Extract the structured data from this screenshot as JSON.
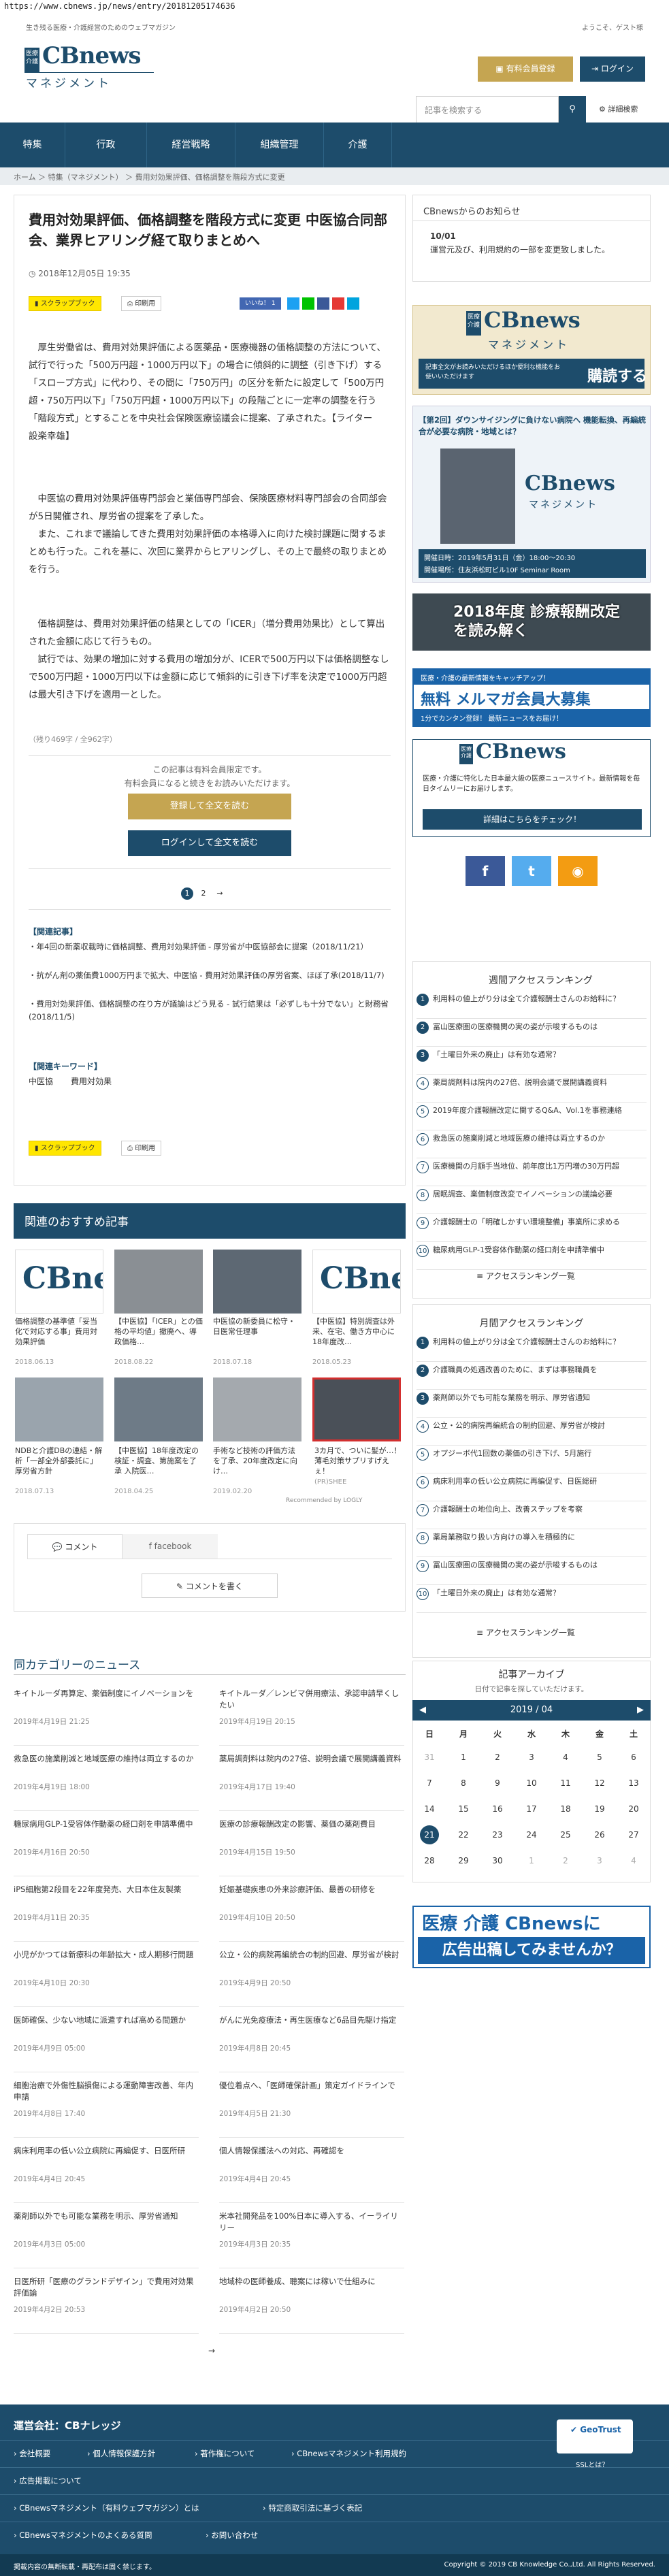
{
  "browser": {
    "url": "https://www.cbnews.jp/news/entry/20181205174636"
  },
  "header": {
    "tagline": "生き残る医療・介護経営のためのウェブマガジン",
    "welcome": "ようこそ、ゲスト様",
    "logo_small": "医療介護",
    "logo_main": "CBnews",
    "logo_sub": "マネジメント",
    "subscribe_label": "有料会員登録",
    "login_label": "ログイン"
  },
  "search": {
    "placeholder": "記事を検索する",
    "advanced_label": "詳細検索"
  },
  "nav": {
    "items": [
      "特集",
      "行政",
      "経営戦略",
      "組織管理",
      "介護"
    ]
  },
  "breadcrumb": {
    "items": [
      "ホーム",
      "特集（マネジメント）",
      "費用対効果評価、価格調整を階段方式に変更"
    ]
  },
  "article": {
    "title": "費用対効果評価、価格調整を階段方式に変更 中医協合同部会、業界ヒアリング経て取りまとめへ",
    "date": "2018年12月05日 19:35",
    "scrapbook_label": "スクラップブック",
    "print_label": "印刷用",
    "likes_label": "いいね！ 1",
    "p1": "　厚生労働省は、費用対効果評価による医薬品・医療機器の価格調整の方法について、試行で行った「500万円超・1000万円以下」の場合に傾斜的に調整（引き下げ）する「スロープ方式」に代わり、その間に「750万円」の区分を新たに設定して「500万円超・750万円以下」「750万円超・1000万円以下」の段階ごとに一定率の調整を行う「階段方式」とすることを中央社会保険医療協議会に提案、了承された。【ライター　設楽幸雄】",
    "p2": "　中医協の費用対効果評価専門部会と業価専門部会、保険医療材料専門部会の合同部会が5日開催され、厚労省の提案を了承した。\n　また、これまで議論してきた費用対効果評価の本格導入に向けた検討課題に関するまとめも行った。これを基に、次回に業界からヒアリングし、その上で最終の取りまとめを行う。",
    "p3": "　価格調整は、費用対効果評価の結果としての「ICER」（増分費用効果比）として算出された金額に応じて行うもの。\n　試行では、効果の増加に対する費用の増加分が、ICERで500万円以下は価格調整なしで500万円超・1000万円以下は金額に応じて傾斜的に引き下げ率を決定で1000万円超は最大引き下げを適用一とした。",
    "remaining": "（残り469字 / 全962字）",
    "paywall_note1": "この記事は有料会員限定です。",
    "paywall_note2": "有料会員になると続きをお読みいただけます。",
    "cta_register": "登録して全文を読む",
    "cta_login": "ログインして全文を読む",
    "pagination": [
      "1",
      "2",
      "→"
    ],
    "related_heading": "【関連記事】",
    "related": [
      "年4回の新薬収載時に価格調整、費用対効果評価 - 厚労省が中医協部会に提案（2018/11/21）",
      "抗がん剤の薬価費1000万円まで拡大、中医協 - 費用対効果評価の厚労省案、ほぼ了承(2018/11/7)",
      "費用対効果評価、価格調整の在り方が議論はどう見る - 試行結果は「必ずしも十分でない」と財務省(2018/11/5)"
    ],
    "keyword_heading": "【関連キーワード】",
    "keywords": [
      "中医協",
      "費用対効果"
    ]
  },
  "recommend": {
    "heading": "関連のおすすめ記事",
    "items": [
      {
        "caption": "価格調整の基準値「妥当化で対応する事」費用対効果評価",
        "date": "2018.06.13"
      },
      {
        "caption": "【中医協】「ICER」との価格の平均値」撤廃へ、導政価格…",
        "date": "2018.08.22"
      },
      {
        "caption": "中医協の新委員に松守・日医常任理事",
        "date": "2018.07.18"
      },
      {
        "caption": "【中医協】特別調査は外来、在宅、働き方中心に 18年度改…",
        "date": "2018.05.23"
      },
      {
        "caption": "NDBと介護DBの連結・解析「一部全外部委託に」厚労省方針",
        "date": "2018.07.13"
      },
      {
        "caption": "【中医協】18年度改定の検証・調査、第施案を了承 入院医…",
        "date": "2018.04.25"
      },
      {
        "caption": "手術など技術の評価方法を了承、20年度改定に向け…",
        "date": "2019.02.20"
      },
      {
        "caption": "3カ月で、ついに髪が…！薄毛対策サプリすげえぇ！",
        "date": "(PR)SHEE"
      }
    ],
    "powered": "Recommended by LOGLY"
  },
  "comments": {
    "tab_comment": "コメント",
    "tab_facebook": "facebook",
    "write_label": "コメントを書く"
  },
  "same_category": {
    "heading": "同カテゴリーのニュース",
    "left": [
      {
        "t": "キイトルーダ再算定、薬価制度にイノベーションを",
        "d": "2019年4月19日 21:25"
      },
      {
        "t": "救急医の施業削減と地域医療の維持は両立するのか",
        "d": "2019年4月19日 18:00"
      },
      {
        "t": "糖尿病用GLP-1受容体作動薬の経口剤を申請準備中",
        "d": "2019年4月16日 20:50"
      },
      {
        "t": "iPS細胞第2段目を22年度発売、大日本住友製薬",
        "d": "2019年4月11日 20:35"
      },
      {
        "t": "小児がかつては新療科の年齢拡大・成人期移行問題",
        "d": "2019年4月10日 20:30"
      },
      {
        "t": "医師確保、少ない地域に派遣すれば高める間題か",
        "d": "2019年4月9日 05:00"
      },
      {
        "t": "細胞治療で外傷性脳損傷による運動障害改善、年内申請",
        "d": "2019年4月8日 17:40"
      },
      {
        "t": "病床利用率の低い公立病院に再編促す、日医所研",
        "d": "2019年4月4日 20:45"
      },
      {
        "t": "薬剤師以外でも可能な業務を明示、厚労省通知",
        "d": "2019年4月3日 05:00"
      },
      {
        "t": "日医所研「医療のグランドデザイン」で費用対効果評価論",
        "d": "2019年4月2日 20:53"
      }
    ],
    "right": [
      {
        "t": "キイトルーダ／レンビマ併用療法、承認申請早くしたい",
        "d": "2019年4月19日 20:15"
      },
      {
        "t": "薬局調剤料は院内の27倍、説明会議で展開講義資料",
        "d": "2019年4月17日 19:40"
      },
      {
        "t": "医療の診療報酬改定の影響、薬価の薬剤費目",
        "d": "2019年4月15日 19:50"
      },
      {
        "t": "妊娠基礎疾患の外来診療評価、最善の研修を",
        "d": "2019年4月10日 20:50"
      },
      {
        "t": "公立・公的病院再編統合の制約回避、厚労省が検討",
        "d": "2019年4月9日 20:50"
      },
      {
        "t": "がんに光免疫療法・再生医療など6品目先駆け指定",
        "d": "2019年4月8日 20:45"
      },
      {
        "t": "優位着点へ、「医師確保計画」策定ガイドラインで",
        "d": "2019年4月5日 21:30"
      },
      {
        "t": "個人情報保護法への対応、再確認を",
        "d": "2019年4月4日 20:45"
      },
      {
        "t": "米本社開発品を100%日本に導入する、イーライリリー",
        "d": "2019年4月3日 20:35"
      },
      {
        "t": "地域枠の医師養成、聴案には稼いで仕組みに",
        "d": "2019年4月2日 20:50"
      }
    ]
  },
  "sidebar": {
    "notice_heading": "CBnewsからのお知らせ",
    "notice_date": "10/01",
    "notice_text": "運営元及び、利用規約の一部を変更致しました。",
    "ad_mgmt_text": "記事全文がお読みいただけるほか便利な機能をお使いいただけます",
    "ad_mgmt_cta": "購読する",
    "seminar_title": "【第2回】ダウンサイジングに負けない病院へ 機能転換、再編統合が必要な病院・地域とは？",
    "seminar_date": "開催日時：2019年5月31日（金）18:00〜20:30",
    "seminar_place": "開催場所：住友浜松町ビル10F Seminar Room",
    "kaitei_text": "2018年度 診療報酬改定を読み解く",
    "mailmag_small": "医療・介護の最新情報をキャッチアップ！",
    "mailmag_big": "無料 メルマガ会員大募集",
    "mailmag_sub": "1分でカンタン登録！ 最新ニュースをお届け！",
    "cbn_text": "医療・介護に特化した日本最大級の医療ニュースサイト。最新情報を毎日タイムリーにお届けします。",
    "cbn_cta": "詳細はこちらをチェック！",
    "weekly_heading": "週間アクセスランキング",
    "weekly": [
      "利用料の値上がり分は全て介護報酬士さんのお給料に？",
      "冨山医療圏の医療機関の実の姿が示唆するものは",
      "「土曜日外来の廃止」は有効な通常？",
      "薬局調剤料は院内の27倍、説明会議で展開講義資料",
      "2019年度介護報酬改定に関するQ&A、Vol.1を事務連絡",
      "救急医の施業削減と地域医療の維持は両立するのか",
      "医療機関の月額手当地位、前年度比1万円増の30万円超",
      "居眠調査、業価制度改変でイノベーションの議論必要",
      "介護報酬士の「明確しかすい環境整備」事業所に求める",
      "糖尿病用GLP-1受容体作動薬の経口剤を申請準備中"
    ],
    "weekly_more": "アクセスランキング一覧",
    "monthly_heading": "月間アクセスランキング",
    "monthly": [
      "利用料の値上がり分は全て介護報酬士さんのお給料に？",
      "介護職員の処遇改善のために、まずは事務職員を",
      "薬剤師以外でも可能な業務を明示、厚労省通知",
      "公立・公的病院再編統合の制約回避、厚労省が検討",
      "オプジーボ代1回数の薬価の引き下げ、5月施行",
      "病床利用率の低い公立病院に再編促す、日医総研",
      "介護報酬士の地位向上、改善ステップを考察",
      "薬局業務取り扱い方向けの導入を積極的に",
      "冨山医療圏の医療機関の実の姿が示唆するものは",
      "「土曜日外来の廃止」は有効な通常？"
    ],
    "monthly_more": "アクセスランキング一覧",
    "archive_heading": "記事アーカイブ",
    "archive_note": "日付で記事を探していただけます。",
    "calendar_month": "2019 / 04",
    "calendar_weekdays": [
      "日",
      "月",
      "火",
      "水",
      "木",
      "金",
      "土"
    ],
    "calendar_days": [
      "31",
      "1",
      "2",
      "3",
      "4",
      "5",
      "6",
      "7",
      "8",
      "9",
      "10",
      "11",
      "12",
      "13",
      "14",
      "15",
      "16",
      "17",
      "18",
      "19",
      "20",
      "21",
      "22",
      "23",
      "24",
      "25",
      "26",
      "27",
      "28",
      "29",
      "30",
      "1",
      "2",
      "3",
      "4"
    ],
    "today": "21",
    "ad_bottom_1": "医療 介護 CBnewsに",
    "ad_bottom_2": "広告出稿してみませんか？"
  },
  "footer": {
    "company": "運営会社：CBナレッジ",
    "links_row1": [
      "会社概要",
      "個人情報保護方針",
      "著作権について",
      "CBnewsマネジメント利用規約"
    ],
    "links_row2": [
      "広告掲載について"
    ],
    "links_row3": [
      "CBnewsマネジメント（有料ウェブマガジン）とは",
      "特定商取引法に基づく表記"
    ],
    "links_row4": [
      "CBnewsマネジメントのよくある質問",
      "お問い合わせ"
    ],
    "ssl_label": "SSLとは？",
    "notice": "掲載内容の無断転載・再配布は固く禁じます。",
    "copyright": "Copyright © 2019 CB Knowledge Co.,Ltd. All Rights Reserved."
  },
  "colors": {
    "brand": "#1d4c6b",
    "gold": "#c5a551",
    "scrap": "#ffe600"
  }
}
